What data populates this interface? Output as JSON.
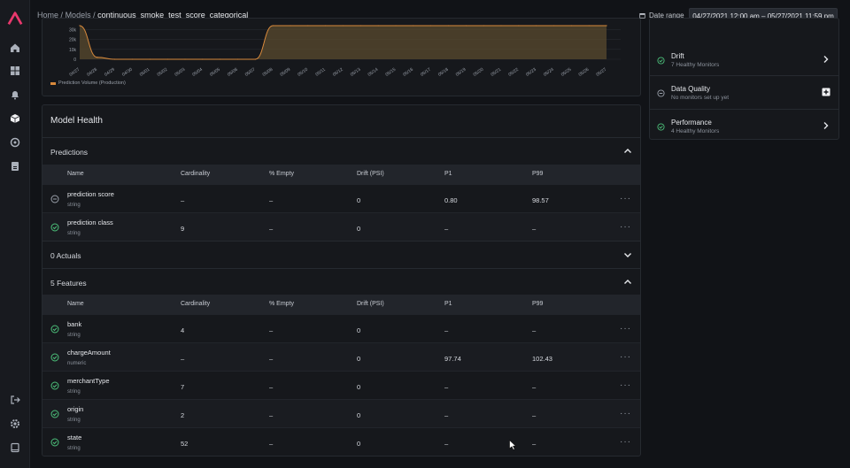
{
  "breadcrumb": {
    "home": "Home",
    "sep": "/",
    "models": "Models",
    "current": "continuous_smoke_test_score_categorical"
  },
  "date_range": {
    "label": "Date range",
    "value": "04/27/2021 12:00 am – 05/27/2021 11:59 pm"
  },
  "chart": {
    "legend": "Prediction Volume (Production)",
    "color": "#d98a3c",
    "y_ticks": [
      "30k",
      "20k",
      "10k",
      "0"
    ],
    "x_ticks": [
      "04/27",
      "04/28",
      "04/29",
      "04/30",
      "05/01",
      "05/02",
      "05/03",
      "05/04",
      "05/05",
      "05/06",
      "05/07",
      "05/08",
      "05/09",
      "05/10",
      "05/11",
      "05/12",
      "05/13",
      "05/14",
      "05/15",
      "05/16",
      "05/17",
      "05/18",
      "05/19",
      "05/20",
      "05/21",
      "05/22",
      "05/23",
      "05/24",
      "05/25",
      "05/26",
      "05/27"
    ]
  },
  "chart_data": {
    "type": "area",
    "x": [
      "04/27",
      "04/28",
      "04/29",
      "04/30",
      "05/01",
      "05/02",
      "05/03",
      "05/04",
      "05/05",
      "05/06",
      "05/07",
      "05/08",
      "05/09",
      "05/10",
      "05/11",
      "05/12",
      "05/13",
      "05/14",
      "05/15",
      "05/16",
      "05/17",
      "05/18",
      "05/19",
      "05/20",
      "05/21",
      "05/22",
      "05/23",
      "05/24",
      "05/25",
      "05/26",
      "05/27"
    ],
    "series": [
      {
        "name": "Prediction Volume (Production)",
        "values": [
          34000,
          2000,
          0,
          0,
          0,
          0,
          0,
          0,
          0,
          0,
          0,
          34000,
          34000,
          34000,
          34000,
          34000,
          34000,
          34000,
          34000,
          34000,
          34000,
          34000,
          34000,
          34000,
          34000,
          34000,
          34000,
          34000,
          34000,
          34000,
          34000
        ]
      }
    ],
    "ylim": [
      0,
      34000
    ]
  },
  "monitors": [
    {
      "title": "Drift",
      "sub": "7 Healthy Monitors",
      "status": "healthy",
      "action": "chevron"
    },
    {
      "title": "Data Quality",
      "sub": "No monitors set up yet",
      "status": "none",
      "action": "add"
    },
    {
      "title": "Performance",
      "sub": "4 Healthy Monitors",
      "status": "healthy",
      "action": "chevron"
    }
  ],
  "model_health": {
    "title": "Model Health",
    "columns": [
      "Name",
      "Cardinality",
      "% Empty",
      "Drift (PSI)",
      "P1",
      "P99"
    ],
    "predictions": {
      "label": "Predictions",
      "rows": [
        {
          "status": "none",
          "name": "prediction score",
          "type": "string",
          "cardinality": "–",
          "empty": "–",
          "drift": "0",
          "p1": "0.80",
          "p99": "98.57"
        },
        {
          "status": "healthy",
          "name": "prediction class",
          "type": "string",
          "cardinality": "9",
          "empty": "–",
          "drift": "0",
          "p1": "–",
          "p99": "–"
        }
      ]
    },
    "actuals": {
      "label": "0 Actuals"
    },
    "features": {
      "label": "5 Features",
      "rows": [
        {
          "status": "healthy",
          "name": "bank",
          "type": "string",
          "cardinality": "4",
          "empty": "–",
          "drift": "0",
          "p1": "–",
          "p99": "–"
        },
        {
          "status": "healthy",
          "name": "chargeAmount",
          "type": "numeric",
          "cardinality": "–",
          "empty": "–",
          "drift": "0",
          "p1": "97.74",
          "p99": "102.43"
        },
        {
          "status": "healthy",
          "name": "merchantType",
          "type": "string",
          "cardinality": "7",
          "empty": "–",
          "drift": "0",
          "p1": "–",
          "p99": "–"
        },
        {
          "status": "healthy",
          "name": "origin",
          "type": "string",
          "cardinality": "2",
          "empty": "–",
          "drift": "0",
          "p1": "–",
          "p99": "–"
        },
        {
          "status": "healthy",
          "name": "state",
          "type": "string",
          "cardinality": "52",
          "empty": "–",
          "drift": "0",
          "p1": "–",
          "p99": "–"
        }
      ]
    },
    "more_label": "···"
  },
  "colors": {
    "accent": "#e8386d",
    "healthy": "#4cc07a",
    "series": "#d98a3c"
  },
  "icons": {
    "sidebar": [
      "logo-icon",
      "home-icon",
      "dashboard-icon",
      "bell-icon",
      "cube-icon",
      "layers-icon",
      "report-icon",
      "logout-icon",
      "settings-icon",
      "book-icon"
    ]
  }
}
